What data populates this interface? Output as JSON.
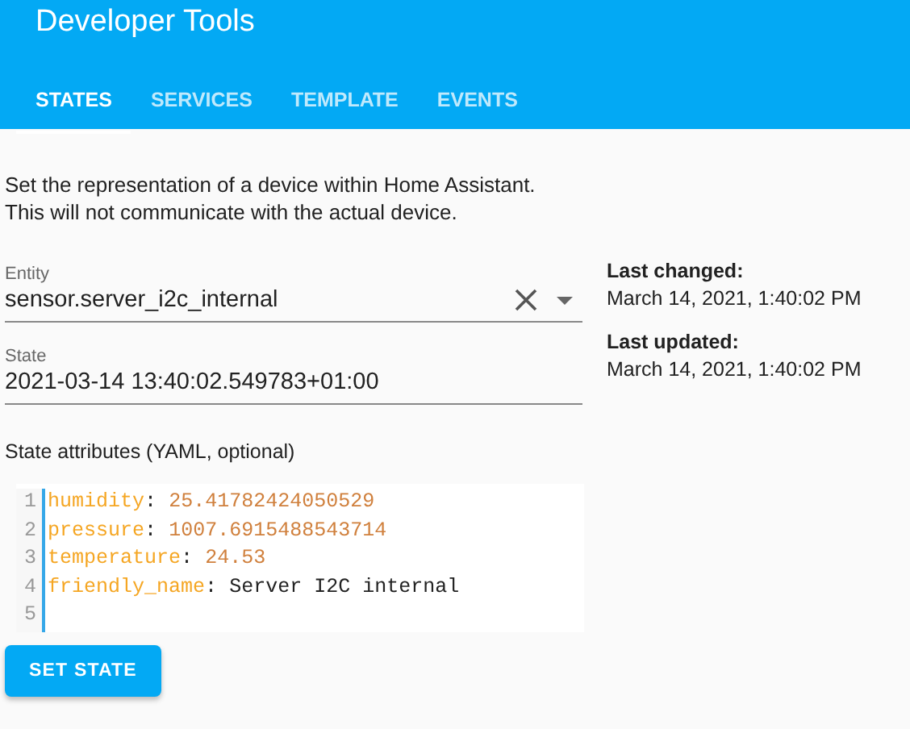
{
  "header": {
    "title": "Developer Tools"
  },
  "tabs": [
    {
      "label": "STATES",
      "selected": true
    },
    {
      "label": "SERVICES",
      "selected": false
    },
    {
      "label": "TEMPLATE",
      "selected": false
    },
    {
      "label": "EVENTS",
      "selected": false
    }
  ],
  "description": [
    "Set the representation of a device within Home Assistant.",
    "This will not communicate with the actual device."
  ],
  "entity_field": {
    "label": "Entity",
    "value": "sensor.server_i2c_internal"
  },
  "state_field": {
    "label": "State",
    "value": "2021-03-14 13:40:02.549783+01:00"
  },
  "info": [
    {
      "label": "Last changed:",
      "value": "March 14, 2021, 1:40:02 PM"
    },
    {
      "label": "Last updated:",
      "value": "March 14, 2021, 1:40:02 PM"
    }
  ],
  "attributes_label": "State attributes (YAML, optional)",
  "editor_lines": [
    {
      "number": "1",
      "key": "humidity",
      "punct": ":",
      "value": "25.41782424050529",
      "kind": "number"
    },
    {
      "number": "2",
      "key": "pressure",
      "punct": ":",
      "value": "1007.6915488543714",
      "kind": "number"
    },
    {
      "number": "3",
      "key": "temperature",
      "punct": ":",
      "value": "24.53",
      "kind": "number"
    },
    {
      "number": "4",
      "key": "friendly_name",
      "punct": ":",
      "value": "Server I2C internal",
      "kind": "string"
    },
    {
      "number": "5"
    }
  ],
  "button": "SET STATE"
}
